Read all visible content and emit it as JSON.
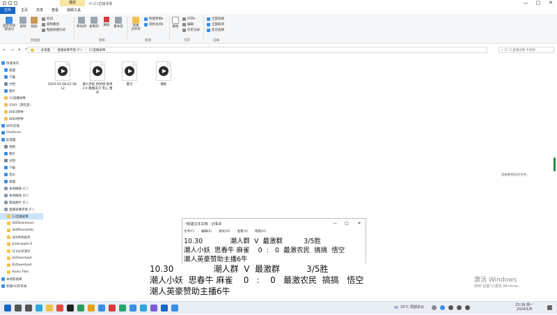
{
  "window": {
    "title": "H:\\11直播录像",
    "context_tab": "播放",
    "buttons": [
      "—",
      "□",
      "✕"
    ]
  },
  "ribbon_tabs": [
    "文件",
    "主页",
    "共享",
    "查看",
    "视频工具"
  ],
  "ribbon": {
    "clipboard": {
      "pin": "固定到快速访问",
      "copy": "复制",
      "paste": "粘贴",
      "cut": "剪切",
      "copy_path": "复制路径",
      "paste_shortcut": "粘贴快捷方式",
      "label": "剪贴板"
    },
    "organize": {
      "move_to": "移动到",
      "copy_to": "复制到",
      "delete": "删除",
      "rename": "重命名",
      "label": "组织"
    },
    "new": {
      "new_folder": "新建\n文件夹",
      "new_item": "新建项目▾",
      "easy_access": "轻松访问▾",
      "label": "新建"
    },
    "open": {
      "properties": "属性",
      "open": "打开▾",
      "edit": "编辑",
      "history": "历史记录",
      "label": "打开"
    },
    "select": {
      "select_all": "全部选择",
      "select_none": "全部取消",
      "invert": "反向选择",
      "label": "选择"
    }
  },
  "address": {
    "nav": [
      "←",
      "→",
      "▾",
      "↑"
    ],
    "crumbs": [
      "此电脑",
      "直播录像存盘 (F:)",
      "11直播录像"
    ],
    "search_placeholder": "在 11直播录像 中搜索"
  },
  "sidebar": {
    "items": [
      {
        "label": "快速访问",
        "color": "#3b8ee6"
      },
      {
        "label": "桌面",
        "color": "#3b8ee6"
      },
      {
        "label": "下载",
        "color": "#3b8ee6"
      },
      {
        "label": "文档",
        "color": "#7a8a9a"
      },
      {
        "label": "图片",
        "color": "#3b8ee6"
      },
      {
        "label": "11直播录像",
        "color": "#f2c14e"
      },
      {
        "label": "0193（黑吃黑）",
        "color": "#f2c14e"
      },
      {
        "label": "8663赞钟",
        "color": "#f2c14e"
      },
      {
        "label": "8669赞钟",
        "color": "#f2c14e"
      },
      {
        "label": "WPS云盘",
        "color": "#3b8ee6"
      },
      {
        "label": "OneDrive",
        "color": "#3b8ee6"
      },
      {
        "label": "此电脑",
        "color": "#3b8ee6"
      },
      {
        "label": "视频",
        "color": "#7a8a9a"
      },
      {
        "label": "图片",
        "color": "#3b8ee6"
      },
      {
        "label": "文档",
        "color": "#7a8a9a"
      },
      {
        "label": "下载",
        "color": "#3b8ee6"
      },
      {
        "label": "音乐",
        "color": "#3b8ee6"
      },
      {
        "label": "桌面",
        "color": "#3b8ee6"
      },
      {
        "label": "本地磁盘 (C:)",
        "color": "#8a9aaa"
      },
      {
        "label": "本地磁盘 (D:)",
        "color": "#8a9aaa"
      },
      {
        "label": "南晶图片 (E:)",
        "color": "#8a9aaa"
      },
      {
        "label": "直播录像存盘 (F:)",
        "color": "#8a9aaa"
      },
      {
        "label": "11直播录像",
        "color": "#f2c14e"
      },
      {
        "label": "360Download",
        "color": "#f2c14e"
      },
      {
        "label": "360PhoneInfo",
        "color": "#f2c14e"
      },
      {
        "label": "360手机助手",
        "color": "#f2c14e"
      },
      {
        "label": "ipswrapper-0",
        "color": "#f2c14e"
      },
      {
        "label": "1FX分享演示",
        "color": "#f2c14e"
      },
      {
        "label": "QLDownload",
        "color": "#f2c14e"
      },
      {
        "label": "QLDownload",
        "color": "#f2c14e"
      },
      {
        "label": "Youku Files",
        "color": "#f2c14e"
      },
      {
        "label": "本地影视库",
        "color": "#3b8ee6"
      },
      {
        "label": "新建(H)存日录",
        "color": "#3b8ee6"
      }
    ]
  },
  "files": [
    {
      "name": "2024-01-08-22-38-12"
    },
    {
      "name": "潮人老赵 各民锐 锁单 3 0 敬凰天只 无心 慧灰"
    },
    {
      "name": "暴刀"
    },
    {
      "name": "碉蛇"
    }
  ],
  "empty_message": "选择要预览的文件。",
  "notepad": {
    "title": "*新建文本文档 - 记事本",
    "menu": [
      "文件(F)",
      "编辑(E)",
      "格式(O)",
      "查看(V)",
      "帮助(H)"
    ],
    "lines": [
      "10.30             潮人群  V  最激群          3/5胜",
      "潮人小妖  思春牛 麻雀    0  :   0  最激农民  搞搞  悟空",
      "潮人英豪赞助主播6牛"
    ]
  },
  "overlay": {
    "lines": [
      "10.30               潮人群  V  最激群          3/5胜",
      "潮人小妖  思春牛 麻雀    0   :    0   最激农民  搞搞   悟空",
      "潮人英豪赞助主播6牛"
    ]
  },
  "activate": {
    "title": "激活 Windows",
    "subtitle": "转到\"设置\"以激活 Windows。"
  },
  "taskbar": {
    "weather": "16°C 局部多云",
    "time": "23:38 周一",
    "date": "2024/1/8",
    "icons": [
      {
        "name": "windows-start-icon",
        "color": "#1a66c4"
      },
      {
        "name": "search-icon",
        "color": "#555"
      },
      {
        "name": "task-view-icon",
        "color": "#555"
      },
      {
        "name": "edge-icon",
        "color": "#2fa6d9"
      },
      {
        "name": "file-explorer-icon",
        "color": "#f2c14e"
      },
      {
        "name": "chrome-icon",
        "color": "#e04a3f"
      },
      {
        "name": "penguin-icon",
        "color": "#222"
      },
      {
        "name": "app-icon-1",
        "color": "#2a9d5c"
      },
      {
        "name": "app-icon-2",
        "color": "#e3a21a"
      },
      {
        "name": "app-icon-3",
        "color": "#3b8ee6"
      },
      {
        "name": "app-icon-4",
        "color": "#d13c3c"
      },
      {
        "name": "app-icon-5",
        "color": "#27a66a"
      },
      {
        "name": "app-icon-6",
        "color": "#3b8ee6"
      },
      {
        "name": "app-icon-7",
        "color": "#2fa6d9"
      },
      {
        "name": "app-icon-8",
        "color": "#7a5cd6"
      },
      {
        "name": "app-icon-9",
        "color": "#1a66c4"
      },
      {
        "name": "notepad-taskbar-icon",
        "color": "#3b8ee6"
      }
    ]
  }
}
